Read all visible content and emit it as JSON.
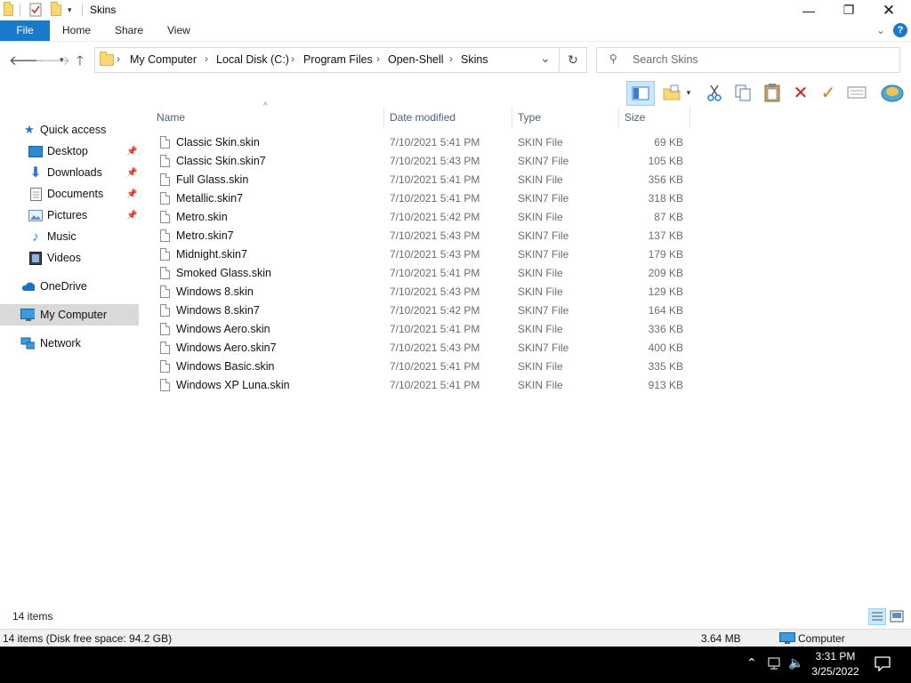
{
  "window": {
    "title": "Skins"
  },
  "ribbon": {
    "tabs": [
      "File",
      "Home",
      "Share",
      "View"
    ]
  },
  "address": {
    "crumbs": [
      "My Computer",
      "Local Disk (C:)",
      "Program Files",
      "Open-Shell",
      "Skins"
    ],
    "search_placeholder": "Search Skins"
  },
  "nav": {
    "items": [
      {
        "label": "Quick access",
        "icon": "star-icon"
      },
      {
        "label": "Desktop",
        "icon": "desktop-icon",
        "pinned": true
      },
      {
        "label": "Downloads",
        "icon": "download-icon",
        "pinned": true
      },
      {
        "label": "Documents",
        "icon": "documents-icon",
        "pinned": true
      },
      {
        "label": "Pictures",
        "icon": "pictures-icon",
        "pinned": true
      },
      {
        "label": "Music",
        "icon": "music-icon"
      },
      {
        "label": "Videos",
        "icon": "videos-icon"
      },
      {
        "label": "OneDrive",
        "icon": "cloud-icon"
      },
      {
        "label": "My Computer",
        "icon": "computer-icon",
        "selected": true
      },
      {
        "label": "Network",
        "icon": "network-icon"
      }
    ]
  },
  "columns": {
    "name": "Name",
    "date": "Date modified",
    "type": "Type",
    "size": "Size"
  },
  "files": [
    {
      "name": "Classic Skin.skin",
      "date": "7/10/2021 5:41 PM",
      "type": "SKIN File",
      "size": "69 KB"
    },
    {
      "name": "Classic Skin.skin7",
      "date": "7/10/2021 5:43 PM",
      "type": "SKIN7 File",
      "size": "105 KB"
    },
    {
      "name": "Full Glass.skin",
      "date": "7/10/2021 5:41 PM",
      "type": "SKIN File",
      "size": "356 KB"
    },
    {
      "name": "Metallic.skin7",
      "date": "7/10/2021 5:41 PM",
      "type": "SKIN7 File",
      "size": "318 KB"
    },
    {
      "name": "Metro.skin",
      "date": "7/10/2021 5:42 PM",
      "type": "SKIN File",
      "size": "87 KB"
    },
    {
      "name": "Metro.skin7",
      "date": "7/10/2021 5:43 PM",
      "type": "SKIN7 File",
      "size": "137 KB"
    },
    {
      "name": "Midnight.skin7",
      "date": "7/10/2021 5:43 PM",
      "type": "SKIN7 File",
      "size": "179 KB"
    },
    {
      "name": "Smoked Glass.skin",
      "date": "7/10/2021 5:41 PM",
      "type": "SKIN File",
      "size": "209 KB"
    },
    {
      "name": "Windows 8.skin",
      "date": "7/10/2021 5:43 PM",
      "type": "SKIN File",
      "size": "129 KB"
    },
    {
      "name": "Windows 8.skin7",
      "date": "7/10/2021 5:42 PM",
      "type": "SKIN7 File",
      "size": "164 KB"
    },
    {
      "name": "Windows Aero.skin",
      "date": "7/10/2021 5:41 PM",
      "type": "SKIN File",
      "size": "336 KB"
    },
    {
      "name": "Windows Aero.skin7",
      "date": "7/10/2021 5:43 PM",
      "type": "SKIN7 File",
      "size": "400 KB"
    },
    {
      "name": "Windows Basic.skin",
      "date": "7/10/2021 5:41 PM",
      "type": "SKIN File",
      "size": "335 KB"
    },
    {
      "name": "Windows XP Luna.skin",
      "date": "7/10/2021 5:41 PM",
      "type": "SKIN File",
      "size": "913 KB"
    }
  ],
  "status": {
    "item_count": "14 items",
    "disk": "14 items (Disk free space: 94.2 GB)",
    "size": "3.64 MB",
    "location": "Computer"
  },
  "taskbar": {
    "time": "3:31 PM",
    "date": "3/25/2022"
  },
  "colors": {
    "accent": "#1979ca",
    "selected": "#d9d9d9"
  }
}
